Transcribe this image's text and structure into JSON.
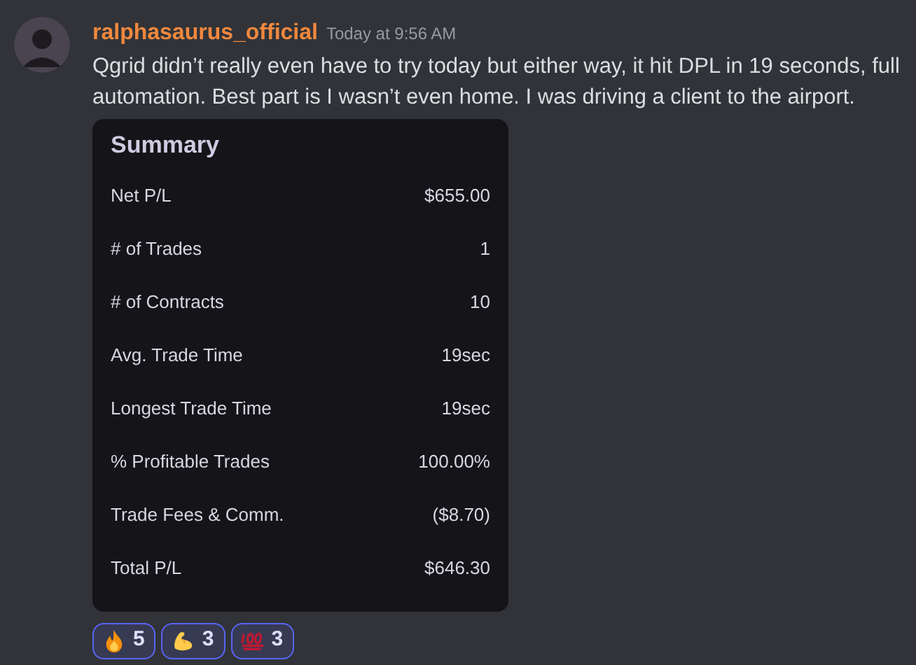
{
  "message": {
    "author": "ralphasaurus_official",
    "timestamp": "Today at 9:56 AM",
    "text": "Qgrid didn’t really even have to try today but either way, it hit DPL in 19 seconds, full automation. Best part is I wasn’t even home. I was driving a client to the airport."
  },
  "summary": {
    "title": "Summary",
    "rows": [
      {
        "label": "Net P/L",
        "value": "$655.00"
      },
      {
        "label": "# of Trades",
        "value": "1"
      },
      {
        "label": "# of Contracts",
        "value": "10"
      },
      {
        "label": "Avg. Trade Time",
        "value": "19sec"
      },
      {
        "label": "Longest Trade Time",
        "value": "19sec"
      },
      {
        "label": "% Profitable Trades",
        "value": "100.00%"
      },
      {
        "label": "Trade Fees & Comm.",
        "value": "($8.70)"
      },
      {
        "label": "Total P/L",
        "value": "$646.30"
      }
    ]
  },
  "reactions": [
    {
      "kind": "fire",
      "count": "5",
      "selected": true
    },
    {
      "kind": "muscle",
      "count": "3",
      "selected": true
    },
    {
      "kind": "hundred",
      "count": "3",
      "selected": true
    }
  ]
}
